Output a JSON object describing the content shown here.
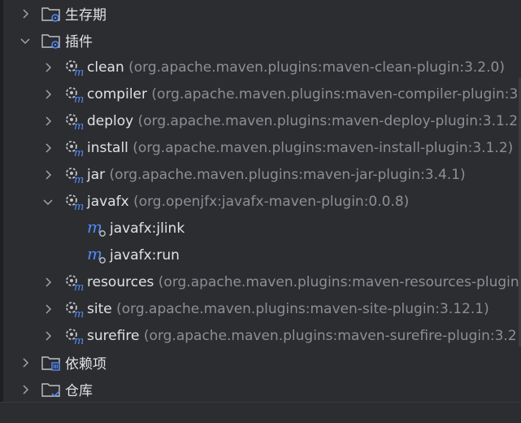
{
  "tree": {
    "lifecycle": {
      "label": "生存期"
    },
    "plugins": {
      "label": "插件",
      "items": [
        {
          "name": "clean",
          "coord": "(org.apache.maven.plugins:maven-clean-plugin:3.2.0)"
        },
        {
          "name": "compiler",
          "coord": "(org.apache.maven.plugins:maven-compiler-plugin:3"
        },
        {
          "name": "deploy",
          "coord": "(org.apache.maven.plugins:maven-deploy-plugin:3.1.2"
        },
        {
          "name": "install",
          "coord": "(org.apache.maven.plugins:maven-install-plugin:3.1.2)"
        },
        {
          "name": "jar",
          "coord": "(org.apache.maven.plugins:maven-jar-plugin:3.4.1)"
        },
        {
          "name": "javafx",
          "coord": "(org.openjfx:javafx-maven-plugin:0.0.8)"
        },
        {
          "name": "resources",
          "coord": "(org.apache.maven.plugins:maven-resources-plugin"
        },
        {
          "name": "site",
          "coord": "(org.apache.maven.plugins:maven-site-plugin:3.12.1)"
        },
        {
          "name": "surefire",
          "coord": "(org.apache.maven.plugins:maven-surefire-plugin:3.2"
        }
      ],
      "javafx_goals": [
        {
          "label": "javafx:jlink"
        },
        {
          "label": "javafx:run"
        }
      ]
    },
    "dependencies": {
      "label": "依赖项"
    },
    "repositories": {
      "label": "仓库"
    }
  },
  "colors": {
    "background": "#2b2d30",
    "text": "#dfe1e5",
    "muted": "#8c8f94",
    "maven_blue": "#548af7"
  },
  "icons": {
    "collapsed": "chevron-right-icon",
    "expanded": "chevron-down-icon",
    "folder_gear": "folder-gear-icon",
    "plugin_gear": "maven-plugin-icon",
    "goal": "maven-goal-icon",
    "folder_lib": "folder-library-icon",
    "folder_repo": "folder-repository-icon"
  }
}
